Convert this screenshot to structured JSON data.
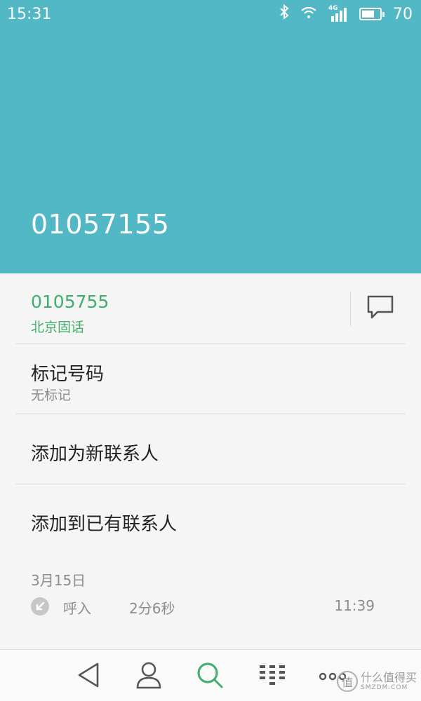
{
  "status_bar": {
    "time": "15:31",
    "network": "4G",
    "battery": "70",
    "battery_level": 0.7
  },
  "header": {
    "number": "01057155"
  },
  "number_row": {
    "number": "0105755",
    "location": "北京固话",
    "message_icon": "message-icon"
  },
  "mark_row": {
    "title": "标记号码",
    "subtitle": "无标记"
  },
  "actions": [
    {
      "label": "添加为新联系人"
    },
    {
      "label": "添加到已有联系人"
    }
  ],
  "call_log": {
    "date": "3月15日",
    "type": "呼入",
    "duration": "2分6秒",
    "time": "11:39"
  },
  "nav": {
    "icons": [
      "back-icon",
      "contacts-icon",
      "search-icon",
      "dialpad-icon",
      "more-icon"
    ],
    "active_color": "#3fae6c"
  },
  "watermark": {
    "logo_char": "值",
    "text": "什么值得买",
    "sub": "SMZDM.COM"
  },
  "colors": {
    "header_bg": "#52b8c6",
    "accent_green": "#3fae6c"
  }
}
